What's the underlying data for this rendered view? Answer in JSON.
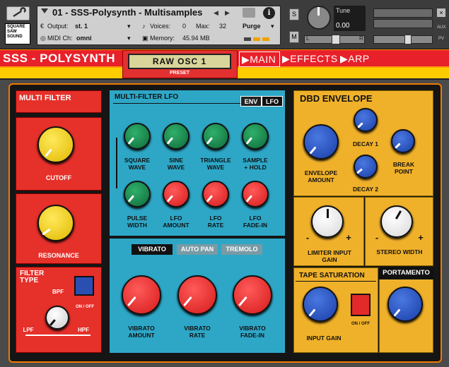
{
  "header": {
    "instrument_name": "01 - SSS-Polysynth - Multisamples",
    "output_label": "Output:",
    "output_value": "st. 1",
    "voices_label": "Voices:",
    "voices_value": "0",
    "max_label": "Max:",
    "max_value": "32",
    "midi_label": "MIDI Ch:",
    "midi_value": "omni",
    "memory_label": "Memory:",
    "memory_value": "45.94 MB",
    "purge_label": "Purge",
    "tune_label": "Tune",
    "tune_value": "0.00",
    "s_label": "S",
    "m_label": "M",
    "aux_label": "AUX",
    "pv_label": "PV",
    "pan_left": "L",
    "pan_right": "R",
    "logo_lines": [
      "SQUARE",
      "SAW",
      "SOUND"
    ]
  },
  "app": {
    "title": "SSS - POLYSYNTH",
    "preset_display": "RAW OSC 1",
    "preset_label": "PRESET"
  },
  "tabs": [
    {
      "label": "▶MAIN"
    },
    {
      "label": "▶EFFECTS"
    },
    {
      "label": "▶ARP"
    }
  ],
  "multi_filter": {
    "title": "MULTI FILTER",
    "cutoff": "CUTOFF",
    "resonance": "RESONANCE",
    "filter_type": "FILTER TYPE",
    "onoff": "ON / OFF",
    "bpf": "BPF",
    "lpf": "LPF",
    "hpf": "HPF"
  },
  "lfo": {
    "title": "MULTI-FILTER LFO",
    "env": "ENV",
    "lfo": "LFO",
    "row1": [
      {
        "l1": "SQUARE",
        "l2": "WAVE"
      },
      {
        "l1": "SINE",
        "l2": "WAVE"
      },
      {
        "l1": "TRIANGLE",
        "l2": "WAVE"
      },
      {
        "l1": "SAMPLE",
        "l2": "+ HOLD"
      }
    ],
    "row2": [
      {
        "l1": "PULSE",
        "l2": "WIDTH"
      },
      {
        "l1": "LFO",
        "l2": "AMOUNT"
      },
      {
        "l1": "LFO",
        "l2": "RATE"
      },
      {
        "l1": "LFO",
        "l2": "FADE-IN"
      }
    ]
  },
  "vibrato": {
    "tabs": [
      "VIBRATO",
      "AUTO PAN",
      "TREMOLO"
    ],
    "knobs": [
      {
        "l1": "VIBRATO",
        "l2": "AMOUNT"
      },
      {
        "l1": "VIBRATO",
        "l2": "RATE"
      },
      {
        "l1": "VIBRATO",
        "l2": "FADE-IN"
      }
    ]
  },
  "dbd": {
    "title": "DBD ENVELOPE",
    "env_amount": [
      "ENVELOPE",
      "AMOUNT"
    ],
    "decay1": "DECAY 1",
    "decay2": "DECAY 2",
    "break": [
      "BREAK",
      "POINT"
    ]
  },
  "limiter": {
    "label": [
      "LIMITER INPUT",
      "GAIN"
    ],
    "minus": "-",
    "plus": "+"
  },
  "stereo": {
    "label": "STEREO WIDTH",
    "minus": "-",
    "plus": "+"
  },
  "tape": {
    "title": "TAPE SATURATION",
    "input_gain": "INPUT GAIN",
    "onoff": "ON / OFF"
  },
  "portamento": {
    "title": "PORTAMENTO"
  }
}
